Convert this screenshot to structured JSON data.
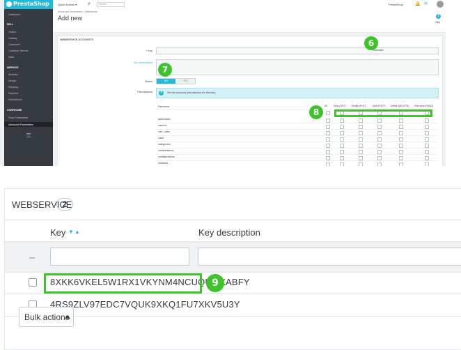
{
  "admin": {
    "logo": "PrestaShop",
    "sidebar": {
      "dashboard": "Dashboard",
      "sell_heading": "SELL",
      "sell_items": [
        "Orders",
        "Catalog",
        "Customers",
        "Customer Service",
        "Stats"
      ],
      "improve_heading": "IMPROVE",
      "improve_items": [
        "Modules",
        "Design",
        "Shipping",
        "Payment",
        "International"
      ],
      "configure_heading": "CONFIGURE",
      "configure_items": [
        "Shop Parameters",
        "Advanced Parameters"
      ]
    },
    "header": {
      "quick_access": "Quick Access ▾",
      "search_placeholder": "Search",
      "shop_name": "PrestaShop"
    },
    "breadcrumb": "Advanced Parameters  /  Webservice",
    "page_title": "Add new",
    "help_label": "Help",
    "form": {
      "panel_title": "WEBSERVICE ACCOUNTS",
      "key_label": "* Key",
      "generate_label": "Generate!",
      "key_description_label": "Key description",
      "status_label": "Status",
      "status_no": "NO",
      "status_yes": "YES",
      "permissions_label": "Permissions",
      "permissions_info": "Set the resource permissions for this key:",
      "columns": {
        "resource": "Resource",
        "all": "All",
        "view": "View (GET)",
        "modify": "Modify (PUT)",
        "add": "Add (POST)",
        "delete": "Delete (DELETE)",
        "fast_view": "Fast view (HEAD)"
      },
      "resources": [
        "addresses",
        "carriers",
        "cart_rules",
        "carts",
        "categories",
        "combinations",
        "configurations",
        "contacts"
      ]
    },
    "badges": {
      "b6": "6",
      "b7": "7",
      "b8": "8"
    }
  },
  "webservice": {
    "title": "WEBSERVICE",
    "count": "2",
    "col_key": "Key",
    "col_key_description": "Key description",
    "filter_dash": "--",
    "rows": [
      {
        "key": "8XKK6VKEL5W1RX1VKYNM4NCUQUMXABFY"
      },
      {
        "key": "4RS9ZLV97EDC7VQUK9XKQ1FU7XKV5U3Y"
      }
    ],
    "bulk_actions": "Bulk actions",
    "badge": "9"
  },
  "colors": {
    "accent": "#25b9d7",
    "highlight_green": "#3ec32a",
    "sidebar_bg": "#363a41"
  }
}
